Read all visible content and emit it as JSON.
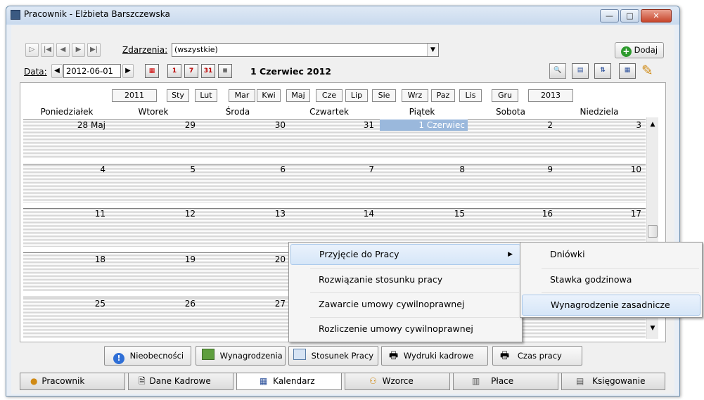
{
  "window": {
    "title": "Pracownik - Elżbieta Barszczewska",
    "buttons": [
      "minimize-icon",
      "maximize-icon",
      "close-icon"
    ]
  },
  "toolbar": {
    "events_label": "Zdarzenia:",
    "events_value": "(wszystkie)",
    "add_label": "Dodaj",
    "date_label": "Data:",
    "date_value": "2012-06-01",
    "current_date": "1 Czerwiec 2012",
    "mini_icons": [
      "1",
      "7",
      "31"
    ]
  },
  "calendar": {
    "year_prev": "2011",
    "year_next": "2013",
    "months": [
      "Sty",
      "Lut",
      "Mar",
      "Kwi",
      "Maj",
      "Cze",
      "Lip",
      "Sie",
      "Wrz",
      "Paz",
      "Lis",
      "Gru"
    ],
    "weekdays": [
      "Poniedziałek",
      "Wtorek",
      "Środa",
      "Czwartek",
      "Piątek",
      "Sobota",
      "Niedziela"
    ],
    "weeks": [
      [
        "28 Maj",
        "29",
        "30",
        "31",
        "1 Czerwiec",
        "2",
        "3"
      ],
      [
        "4",
        "5",
        "6",
        "7",
        "8",
        "9",
        "10"
      ],
      [
        "11",
        "12",
        "13",
        "14",
        "15",
        "16",
        "17"
      ],
      [
        "18",
        "19",
        "20",
        "",
        "",
        "",
        ""
      ],
      [
        "25",
        "26",
        "27",
        "",
        "",
        "",
        ""
      ]
    ],
    "selected_day": "1 Czerwiec",
    "selected_color": "#9ab8dc"
  },
  "context_menu": {
    "items": [
      "Przyjęcie do Pracy",
      "Rozwiązanie stosunku pracy",
      "Zawarcie umowy cywilnoprawnej",
      "Rozliczenie umowy cywilnoprawnej"
    ],
    "submenu": [
      "Dniówki",
      "Stawka godzinowa",
      "Wynagrodzenie zasadnicze"
    ]
  },
  "bottom_buttons": [
    "Nieobecności",
    "Wynagrodzenia",
    "Stosunek Pracy",
    "Wydruki kadrowe",
    "Czas pracy"
  ],
  "tabs": [
    "Pracownik",
    "Dane Kadrowe",
    "Kalendarz",
    "Wzorce",
    "Płace",
    "Księgowanie"
  ]
}
